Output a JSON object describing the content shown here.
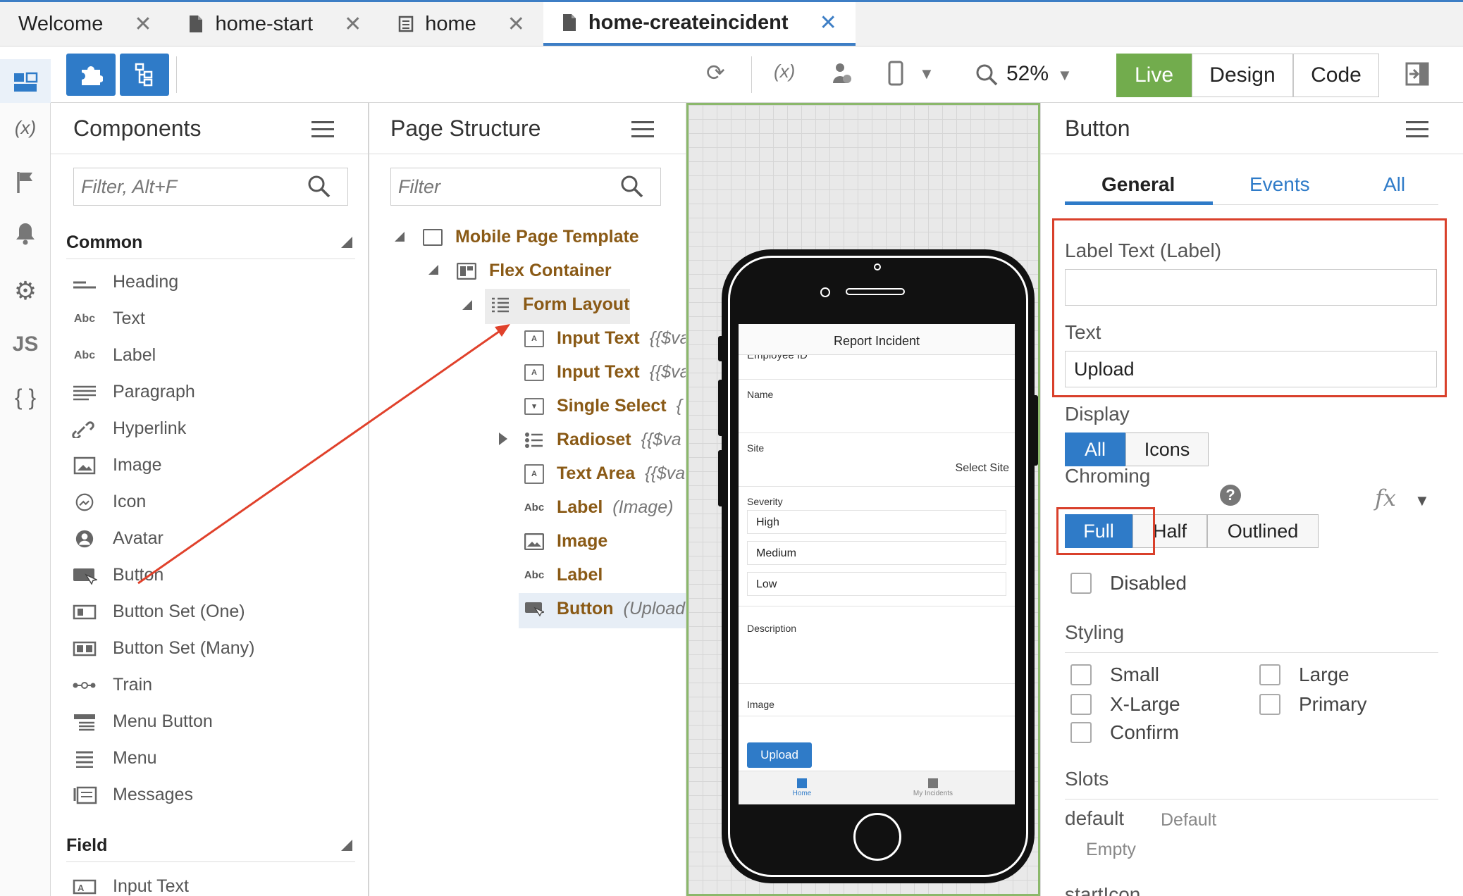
{
  "tabs": [
    {
      "label": "Welcome",
      "icon": ""
    },
    {
      "label": "home-start",
      "icon": "file-icon"
    },
    {
      "label": "home",
      "icon": "page-icon"
    },
    {
      "label": "home-createincident",
      "icon": "file-icon"
    }
  ],
  "toolbar": {
    "zoom": "52%",
    "modes": [
      "Live",
      "Design",
      "Code"
    ]
  },
  "components": {
    "title": "Components",
    "filter_placeholder": "Filter, Alt+F",
    "common_header": "Common",
    "common_items": [
      "Heading",
      "Text",
      "Label",
      "Paragraph",
      "Hyperlink",
      "Image",
      "Icon",
      "Avatar",
      "Button",
      "Button Set (One)",
      "Button Set (Many)",
      "Train",
      "Menu Button",
      "Menu",
      "Messages"
    ],
    "field_header": "Field",
    "field_items": [
      "Input Text"
    ],
    "abc": "Abc"
  },
  "structure": {
    "title": "Page Structure",
    "filter_placeholder": "Filter",
    "nodes": [
      {
        "label": "Mobile Page Template",
        "extra": ""
      },
      {
        "label": "Flex Container",
        "extra": ""
      },
      {
        "label": "Form Layout",
        "extra": ""
      },
      {
        "label": "Input Text",
        "extra": "{{$va"
      },
      {
        "label": "Input Text",
        "extra": "{{$va"
      },
      {
        "label": "Single Select",
        "extra": "{"
      },
      {
        "label": "Radioset",
        "extra": "{{$va"
      },
      {
        "label": "Text Area",
        "extra": "{{$va"
      },
      {
        "label": "Label",
        "extra": "(Image)"
      },
      {
        "label": "Image",
        "extra": ""
      },
      {
        "label": "Label",
        "extra": ""
      },
      {
        "label": "Button",
        "extra": "(Upload"
      }
    ]
  },
  "preview": {
    "screen_title": "Report Incident",
    "employee_label": "Employee ID",
    "name_label": "Name",
    "site_label": "Site",
    "site_value": "Select Site",
    "severity_label": "Severity",
    "severity_options": [
      "High",
      "Medium",
      "Low"
    ],
    "description_label": "Description",
    "image_label": "Image",
    "upload_button": "Upload",
    "nav_tabs": [
      "Home",
      "My Incidents"
    ]
  },
  "properties": {
    "title": "Button",
    "tabs": [
      "General",
      "Events",
      "All"
    ],
    "label_text_label": "Label Text (Label)",
    "label_text_value": "",
    "text_label": "Text",
    "text_value": "Upload",
    "display_label": "Display",
    "display_options": [
      "All",
      "Icons"
    ],
    "chroming_label": "Chroming",
    "chroming_options": [
      "Full",
      "Half",
      "Outlined"
    ],
    "fx": "fx",
    "help": "?",
    "disabled_label": "Disabled",
    "styling_label": "Styling",
    "styling_options": [
      "Small",
      "Large",
      "X-Large",
      "Primary",
      "Confirm"
    ],
    "slots_label": "Slots",
    "slot_name": "default",
    "slot_default": "Default",
    "slot_empty": "Empty",
    "next_slot": "startIcon"
  },
  "colors": {
    "accent": "#2f7bc8",
    "live": "#72ac4d",
    "node": "#8a5a16",
    "highlight": "#d9402b"
  }
}
